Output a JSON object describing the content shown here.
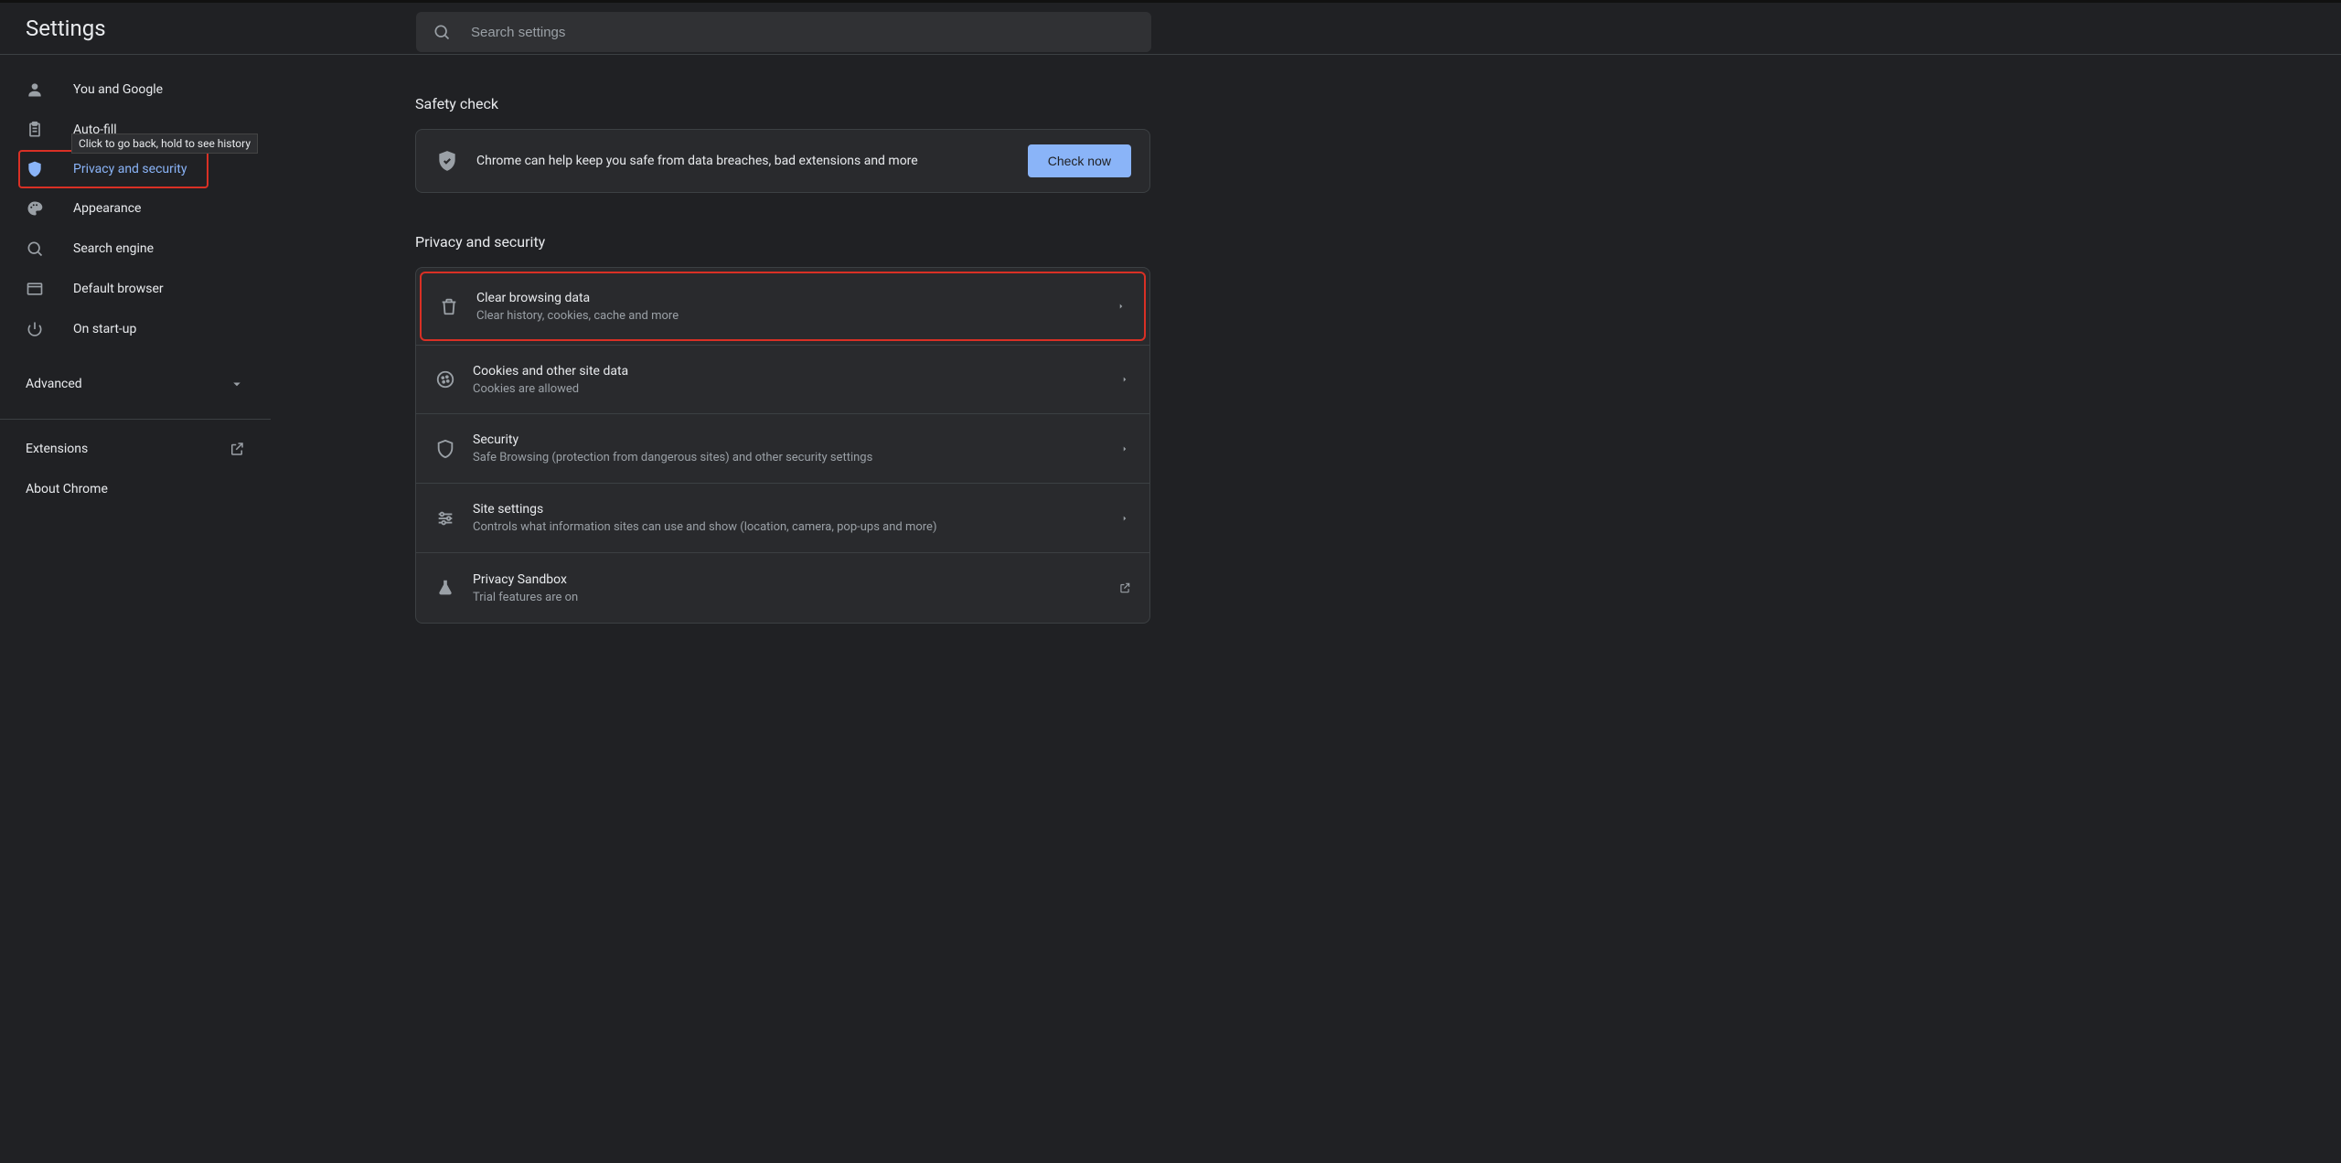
{
  "pageTitle": "Settings",
  "search": {
    "placeholder": "Search settings"
  },
  "tooltip": "Click to go back, hold to see history",
  "sidebar": {
    "items": [
      {
        "label": "You and Google"
      },
      {
        "label": "Auto-fill"
      },
      {
        "label": "Privacy and security"
      },
      {
        "label": "Appearance"
      },
      {
        "label": "Search engine"
      },
      {
        "label": "Default browser"
      },
      {
        "label": "On start-up"
      }
    ],
    "advanced": "Advanced",
    "extensions": "Extensions",
    "about": "About Chrome"
  },
  "sections": {
    "safety": {
      "heading": "Safety check",
      "text": "Chrome can help keep you safe from data breaches, bad extensions and more",
      "button": "Check now"
    },
    "privacy": {
      "heading": "Privacy and security",
      "rows": [
        {
          "title": "Clear browsing data",
          "sub": "Clear history, cookies, cache and more"
        },
        {
          "title": "Cookies and other site data",
          "sub": "Cookies are allowed"
        },
        {
          "title": "Security",
          "sub": "Safe Browsing (protection from dangerous sites) and other security settings"
        },
        {
          "title": "Site settings",
          "sub": "Controls what information sites can use and show (location, camera, pop-ups and more)"
        },
        {
          "title": "Privacy Sandbox",
          "sub": "Trial features are on"
        }
      ]
    }
  }
}
